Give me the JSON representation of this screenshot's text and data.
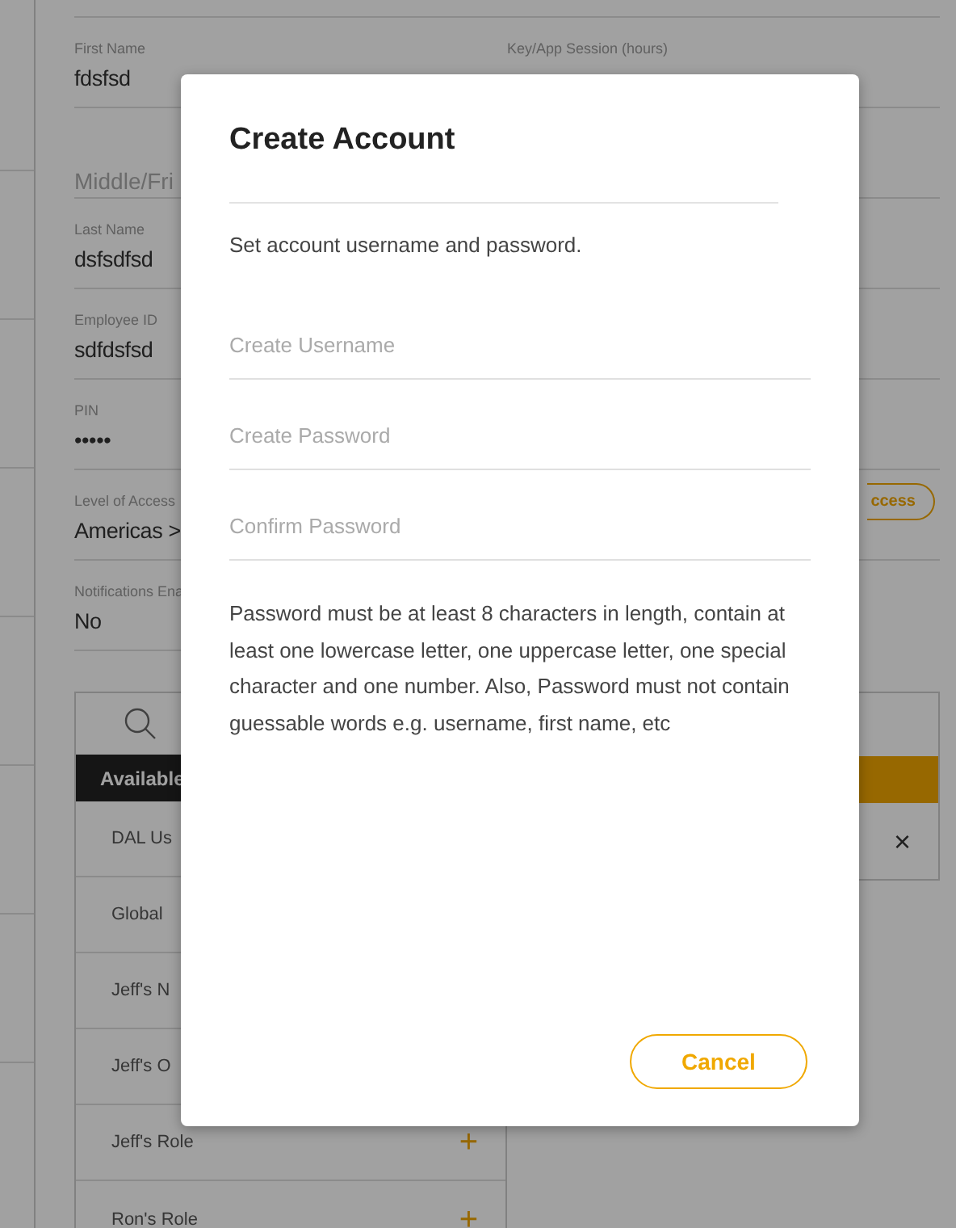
{
  "form": {
    "left_fields": [
      {
        "label": "First Name",
        "value": "fdsfsd"
      },
      {
        "placeholder": "Middle/Fri"
      },
      {
        "label": "Last Name",
        "value": "dsfsdfsd"
      },
      {
        "label": "Employee ID",
        "value": "sdfdsfsd"
      },
      {
        "label": "PIN",
        "value": "•••••"
      },
      {
        "label": "Level of Access",
        "value": "Americas >"
      },
      {
        "label": "Notifications Ena",
        "value": "No"
      }
    ],
    "right_fields": [
      {
        "label": "Key/App Session (hours)"
      }
    ],
    "access_button": "ccess"
  },
  "roles": {
    "available_header": "Available",
    "available": [
      {
        "name": "DAL Us"
      },
      {
        "name": "Global"
      },
      {
        "name": "Jeff's N"
      },
      {
        "name": "Jeff's O"
      },
      {
        "name": "Jeff's Role",
        "action": "+"
      },
      {
        "name": "Ron's Role",
        "action": "+"
      }
    ],
    "assigned": [
      {
        "remove": "×"
      }
    ]
  },
  "modal": {
    "title": "Create Account",
    "subtitle": "Set account username and password.",
    "fields": [
      {
        "placeholder": "Create Username"
      },
      {
        "placeholder": "Create Password"
      },
      {
        "placeholder": "Confirm Password"
      }
    ],
    "rules": "Password must be at least 8 characters in length, contain at least one lowercase letter, one uppercase letter, one special character and one number. Also, Password must not contain guessable words e.g. username, first name, etc",
    "buttons": [
      "Cancel"
    ]
  }
}
